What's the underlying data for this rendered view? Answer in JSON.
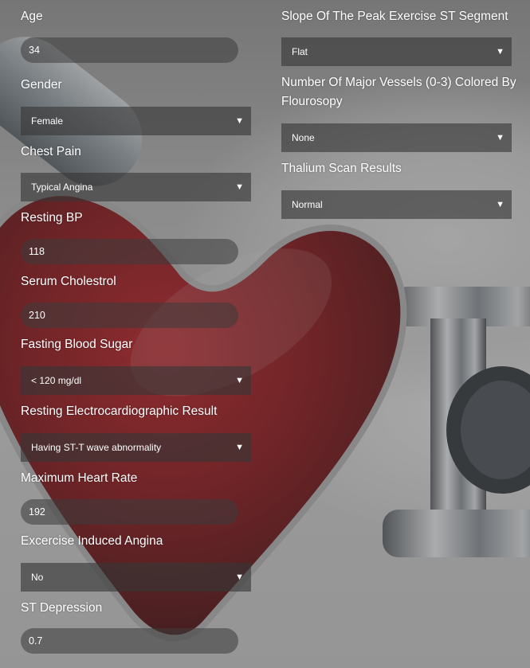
{
  "left_column": {
    "age": {
      "label": "Age",
      "value": "34"
    },
    "gender": {
      "label": "Gender",
      "selected": "Female"
    },
    "chest_pain": {
      "label": "Chest Pain",
      "selected": "Typical Angina"
    },
    "resting_bp": {
      "label": "Resting BP",
      "value": "118"
    },
    "serum_cholestrol": {
      "label": "Serum Cholestrol",
      "value": "210"
    },
    "fasting_blood_sugar": {
      "label": "Fasting Blood Sugar",
      "selected": "< 120 mg/dl"
    },
    "resting_ecg": {
      "label": "Resting Electrocardiographic Result",
      "selected": "Having ST-T wave abnormality"
    },
    "max_heart_rate": {
      "label": "Maximum Heart Rate",
      "value": "192"
    },
    "exercise_angina": {
      "label": "Excercise Induced Angina",
      "selected": "No"
    },
    "st_depression": {
      "label": "ST Depression",
      "value": "0.7"
    }
  },
  "right_column": {
    "slope": {
      "label": "Slope Of The Peak Exercise ST Segment",
      "selected": "Flat"
    },
    "major_vessels": {
      "label": "Number Of Major Vessels (0-3) Colored By Flourosopy",
      "selected": "None"
    },
    "thalium": {
      "label": "Thalium Scan Results",
      "selected": "Normal"
    }
  },
  "icons": {
    "dropdown": "caret-down-icon",
    "caret_glyph": "▼"
  },
  "colors": {
    "text": "#ffffff",
    "field_bg": "#3c3c3c",
    "heart": "#8b0d12"
  }
}
